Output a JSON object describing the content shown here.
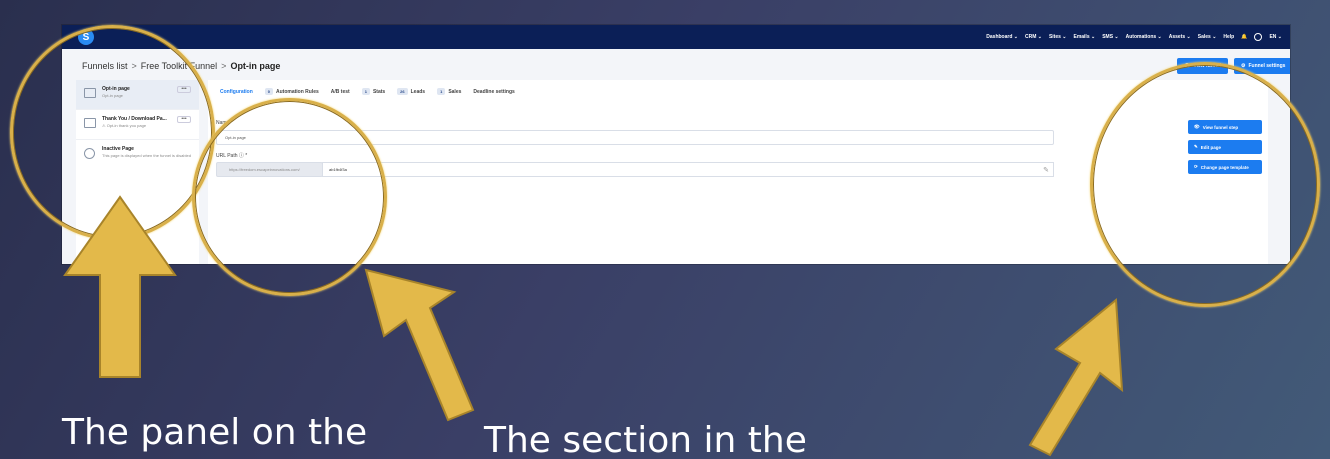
{
  "screenshot": {
    "logo_letter": "S",
    "nav": [
      "Dashboard ⌄",
      "CRM ⌄",
      "Sites ⌄",
      "Emails ⌄",
      "SMS ⌄",
      "Automations ⌄",
      "Assets ⌄",
      "Sales ⌄",
      "Help",
      "EN ⌄"
    ],
    "breadcrumb": {
      "root": "Funnels list",
      "parent": "Free Toolkit Funnel",
      "current": "Opt-in page",
      "sep": ">"
    },
    "top_buttons": {
      "view_funnel": "View funnel",
      "funnel_settings": "Funnel settings"
    },
    "sidebar": [
      {
        "title": "Opt-in page",
        "sub": "Opt-in page",
        "more": "•••"
      },
      {
        "title": "Thank You / Download Pa...",
        "sub": "⚠ Opt-in thank you page",
        "more": "•••"
      },
      {
        "title": "Inactive Page",
        "sub": "This page is displayed when the funnel is disabled"
      }
    ],
    "tabs": [
      {
        "label": "Configuration",
        "badge": ""
      },
      {
        "label": "Automation Rules",
        "badge": "0"
      },
      {
        "label": "A/B test",
        "badge": ""
      },
      {
        "label": "Stats",
        "badge": "1"
      },
      {
        "label": "Leads",
        "badge": "26"
      },
      {
        "label": "Sales",
        "badge": "1"
      },
      {
        "label": "Deadline settings",
        "badge": ""
      }
    ],
    "form": {
      "name_label": "Name *",
      "name_value": "Opt-in page",
      "url_label": "URL Path ⓘ *",
      "url_prefix": "https://freedom.escapeinnovations.com/",
      "url_value": "ab1fb4f3a"
    },
    "side_actions": {
      "view_step": "View funnel step",
      "edit_page": "Edit page",
      "change_template": "Change page template"
    }
  },
  "annotations": {
    "caption_left": "The panel on the",
    "caption_middle": "The section in the",
    "ring_color": "#d9b04a",
    "arrow_color": "#e3b94a"
  }
}
